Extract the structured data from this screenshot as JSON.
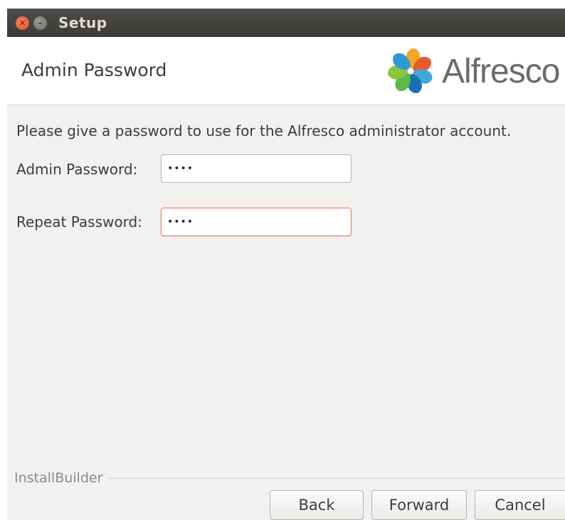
{
  "window": {
    "title": "Setup",
    "close_glyph": "×",
    "minimize_glyph": "–"
  },
  "header": {
    "title": "Admin Password",
    "logo_text": "Alfresco"
  },
  "main": {
    "description": "Please give a password to use for the Alfresco administrator account.",
    "fields": [
      {
        "label": "Admin Password:",
        "value": "••••"
      },
      {
        "label": "Repeat Password:",
        "value": "••••"
      }
    ]
  },
  "footer": {
    "installer_label": "InstallBuilder",
    "back_label": "Back",
    "forward_label": "Forward",
    "cancel_label": "Cancel"
  },
  "colors": {
    "titlebar": "#3c3b37",
    "close_button": "#e0501d",
    "focus_border": "#e4825a",
    "background": "#f2f1f0"
  }
}
